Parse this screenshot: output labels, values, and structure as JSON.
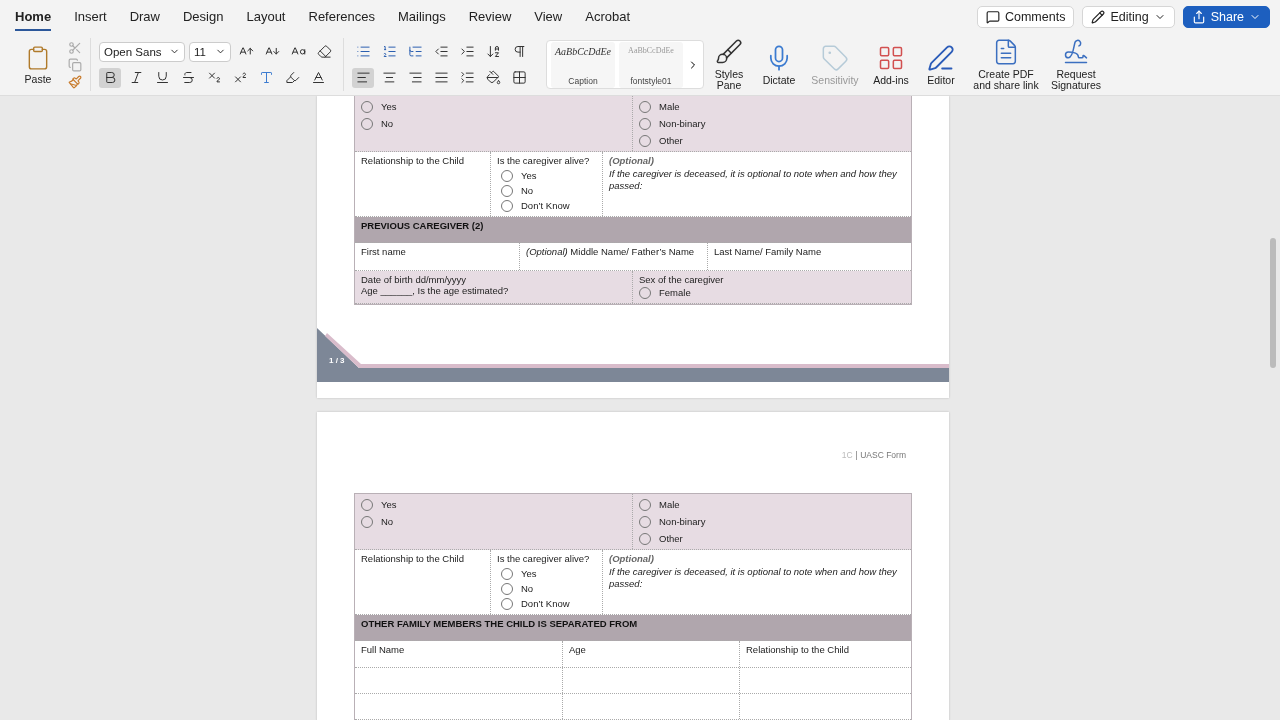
{
  "ribbon": {
    "tabs": [
      {
        "label": "Home",
        "selected": true
      },
      {
        "label": "Insert",
        "selected": false
      },
      {
        "label": "Draw",
        "selected": false
      },
      {
        "label": "Design",
        "selected": false
      },
      {
        "label": "Layout",
        "selected": false
      },
      {
        "label": "References",
        "selected": false
      },
      {
        "label": "Mailings",
        "selected": false
      },
      {
        "label": "Review",
        "selected": false
      },
      {
        "label": "View",
        "selected": false
      },
      {
        "label": "Acrobat",
        "selected": false
      }
    ],
    "actions": [
      {
        "kind": "comments",
        "label": "Comments"
      },
      {
        "kind": "editing",
        "label": "Editing"
      },
      {
        "kind": "share",
        "label": "Share"
      }
    ],
    "paste": "Paste",
    "font": {
      "name": "Open Sans",
      "size": "11",
      "bold": true,
      "italic": false,
      "underline": false
    },
    "paragraph": {
      "align_left": true
    },
    "styles": [
      {
        "preview": "AaBbCcDdEe",
        "name": "Caption"
      },
      {
        "preview": "AaBbCcDdEe",
        "name": "fontstyle01"
      }
    ],
    "tools": [
      {
        "kind": "styles",
        "label": "Styles Pane",
        "disabled": false
      },
      {
        "kind": "dictate",
        "label": "Dictate",
        "disabled": false
      },
      {
        "kind": "sensitivity",
        "label": "Sensitivity",
        "disabled": true
      },
      {
        "kind": "addins",
        "label": "Add-ins",
        "disabled": false
      },
      {
        "kind": "editor",
        "label": "Editor",
        "disabled": false
      },
      {
        "kind": "pdf",
        "label": "Create PDF and share link",
        "disabled": false
      },
      {
        "kind": "sign",
        "label": "Request Signatures",
        "disabled": false
      }
    ]
  },
  "pages": [
    {
      "footer": {
        "page": "1 / 3"
      },
      "blocks": [
        {
          "kind": "radios",
          "left": [
            "Yes",
            "No"
          ],
          "right": [
            "Male",
            "Non-binary",
            "Other"
          ]
        },
        {
          "kind": "status",
          "relationship": "Relationship to the Child",
          "question": "Is the caregiver alive?",
          "options": [
            "Yes",
            "No",
            "Don’t Know"
          ],
          "optional": "(Optional)",
          "note": "If the caregiver is deceased, it is optional to note when and how they passed:"
        },
        {
          "kind": "section",
          "title": "PREVIOUS CAREGIVER (2)"
        },
        {
          "kind": "names",
          "cells": [
            "First name",
            "*(Optional)* Middle Name/ Father’s Name",
            "Last Name/ Family Name"
          ]
        },
        {
          "kind": "dob",
          "dob": "Date of birth dd/mm/yyyy",
          "age": "Age ______, Is the age estimated?",
          "sex": "Sex of the caregiver",
          "options": [
            "Female"
          ]
        }
      ]
    },
    {
      "header": {
        "code": "1C",
        "title": "| UASC Form"
      },
      "blocks": [
        {
          "kind": "radios",
          "left": [
            "Yes",
            "No"
          ],
          "right": [
            "Male",
            "Non-binary",
            "Other"
          ]
        },
        {
          "kind": "status",
          "relationship": "Relationship to the Child",
          "question": "Is the caregiver alive?",
          "options": [
            "Yes",
            "No",
            "Don’t Know"
          ],
          "optional": "(Optional)",
          "note": "If the caregiver is deceased, it is optional to note when and how they passed:"
        },
        {
          "kind": "section",
          "title": "OTHER FAMILY MEMBERS THE CHILD IS SEPARATED FROM"
        },
        {
          "kind": "table",
          "columns": [
            "Full Name",
            "Age",
            "Relationship to the Child"
          ]
        }
      ]
    }
  ]
}
